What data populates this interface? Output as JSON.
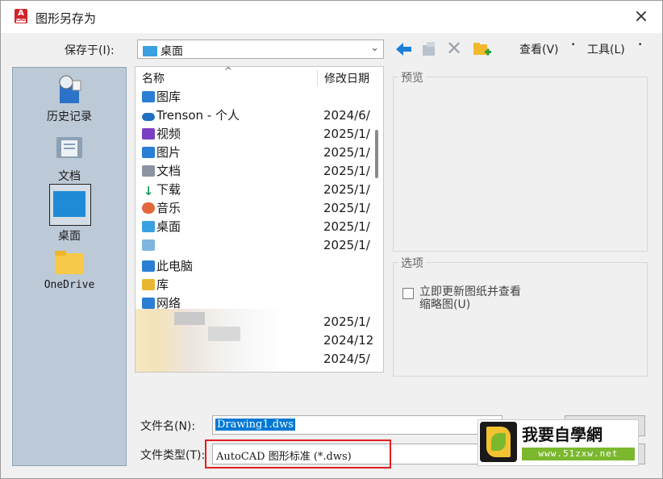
{
  "window": {
    "title": "图形另存为",
    "close": "×"
  },
  "toolbar": {
    "save_in_label": "保存于(I):",
    "save_in_value": "桌面",
    "view_menu": "查看(V)",
    "tools_menu": "工具(L)",
    "menu_arrow": "•"
  },
  "sidebar": {
    "items": [
      {
        "label": "历史记录",
        "icon": "history-icon"
      },
      {
        "label": "文档",
        "icon": "documents-icon"
      },
      {
        "label": "桌面",
        "icon": "desktop-icon"
      },
      {
        "label": "OneDrive",
        "icon": "onedrive-folder-icon"
      }
    ]
  },
  "filelist": {
    "headers": {
      "name": "名称",
      "date": "修改日期"
    },
    "rows": [
      {
        "name": "图库",
        "date": "",
        "icon": "gallery-icon",
        "color": "#2a7fd4"
      },
      {
        "name": "Trenson - 个人",
        "date": "2024/6/",
        "icon": "onedrive-cloud-icon",
        "color": "#1f6fc2"
      },
      {
        "name": "视频",
        "date": "2025/1/",
        "icon": "videos-icon",
        "color": "#7b3fc4"
      },
      {
        "name": "图片",
        "date": "2025/1/",
        "icon": "pictures-icon",
        "color": "#2a7fd4"
      },
      {
        "name": "文档",
        "date": "2025/1/",
        "icon": "documents-icon",
        "color": "#8a94a0"
      },
      {
        "name": "下载",
        "date": "2025/1/",
        "icon": "download-icon",
        "color": "#1a9a5a"
      },
      {
        "name": "音乐",
        "date": "2025/1/",
        "icon": "music-icon",
        "color": "#e2683c"
      },
      {
        "name": "桌面",
        "date": "2025/1/",
        "icon": "desktop-icon",
        "color": "#3aa0e0"
      },
      {
        "name": "",
        "date": "2025/1/",
        "icon": "folder-icon",
        "color": "#7fb6e0"
      },
      {
        "name": "此电脑",
        "date": "",
        "icon": "computer-icon",
        "color": "#2a7fd4"
      },
      {
        "name": "库",
        "date": "",
        "icon": "library-icon",
        "color": "#e8b631"
      },
      {
        "name": "网络",
        "date": "",
        "icon": "network-icon",
        "color": "#2a7fd4"
      },
      {
        "name": "",
        "date": "2025/1/",
        "icon": "",
        "color": ""
      },
      {
        "name": "",
        "date": "2024/12",
        "icon": "",
        "color": ""
      },
      {
        "name": "",
        "date": "2024/5/",
        "icon": "",
        "color": ""
      }
    ]
  },
  "preview": {
    "label": "预览"
  },
  "options": {
    "label": "选项",
    "checkbox_label_line1": "立即更新图纸并查看",
    "checkbox_label_line2": "缩略图(U)"
  },
  "filename": {
    "label": "文件名(N):",
    "value": "Drawing1.dws"
  },
  "filetype": {
    "label": "文件类型(T):",
    "value": "AutoCAD 图形标准 (*.dws)"
  },
  "watermark": {
    "line1": "我要自學網",
    "line2": "www.51zxw.net"
  },
  "colors": {
    "sidebar": "#bcc9d6",
    "accent": "#0078d4",
    "highlight_box": "#e02020"
  }
}
